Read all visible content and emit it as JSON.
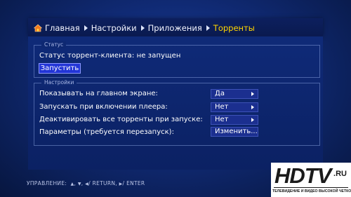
{
  "breadcrumb": {
    "items": [
      "Главная",
      "Настройки",
      "Приложения",
      "Торренты"
    ]
  },
  "status_group": {
    "title": "Статус",
    "status_text": "Статус торрент-клиента: не запущен",
    "start_button": "Запустить"
  },
  "settings_group": {
    "title": "Настройки",
    "rows": [
      {
        "label": "Показывать на главном экране:",
        "value": "Да"
      },
      {
        "label": "Запускать при включении плеера:",
        "value": "Нет"
      },
      {
        "label": "Деактивировать все торренты при запуске:",
        "value": "Нет"
      },
      {
        "label": "Параметры (требуется перезапуск):",
        "value": "Изменить..."
      }
    ]
  },
  "hint": {
    "prefix": "УПРАВЛЕНИЕ:",
    "return_label": "RETURN,",
    "enter_label": "ENTER"
  },
  "logo": {
    "main": "HDTV",
    "suffix": ".RU",
    "tagline": "ТЕЛЕВИДЕНИЕ И ВИДЕО ВЫСОКОЙ ЧЕТКОСТИ"
  },
  "colors": {
    "current_crumb": "#ffd400",
    "button_fill": "#2235d6"
  },
  "icons": [
    "home-icon",
    "chevron-right-icon",
    "arrow-up-icon",
    "arrow-down-icon",
    "arrow-left-icon",
    "arrow-right-icon"
  ]
}
